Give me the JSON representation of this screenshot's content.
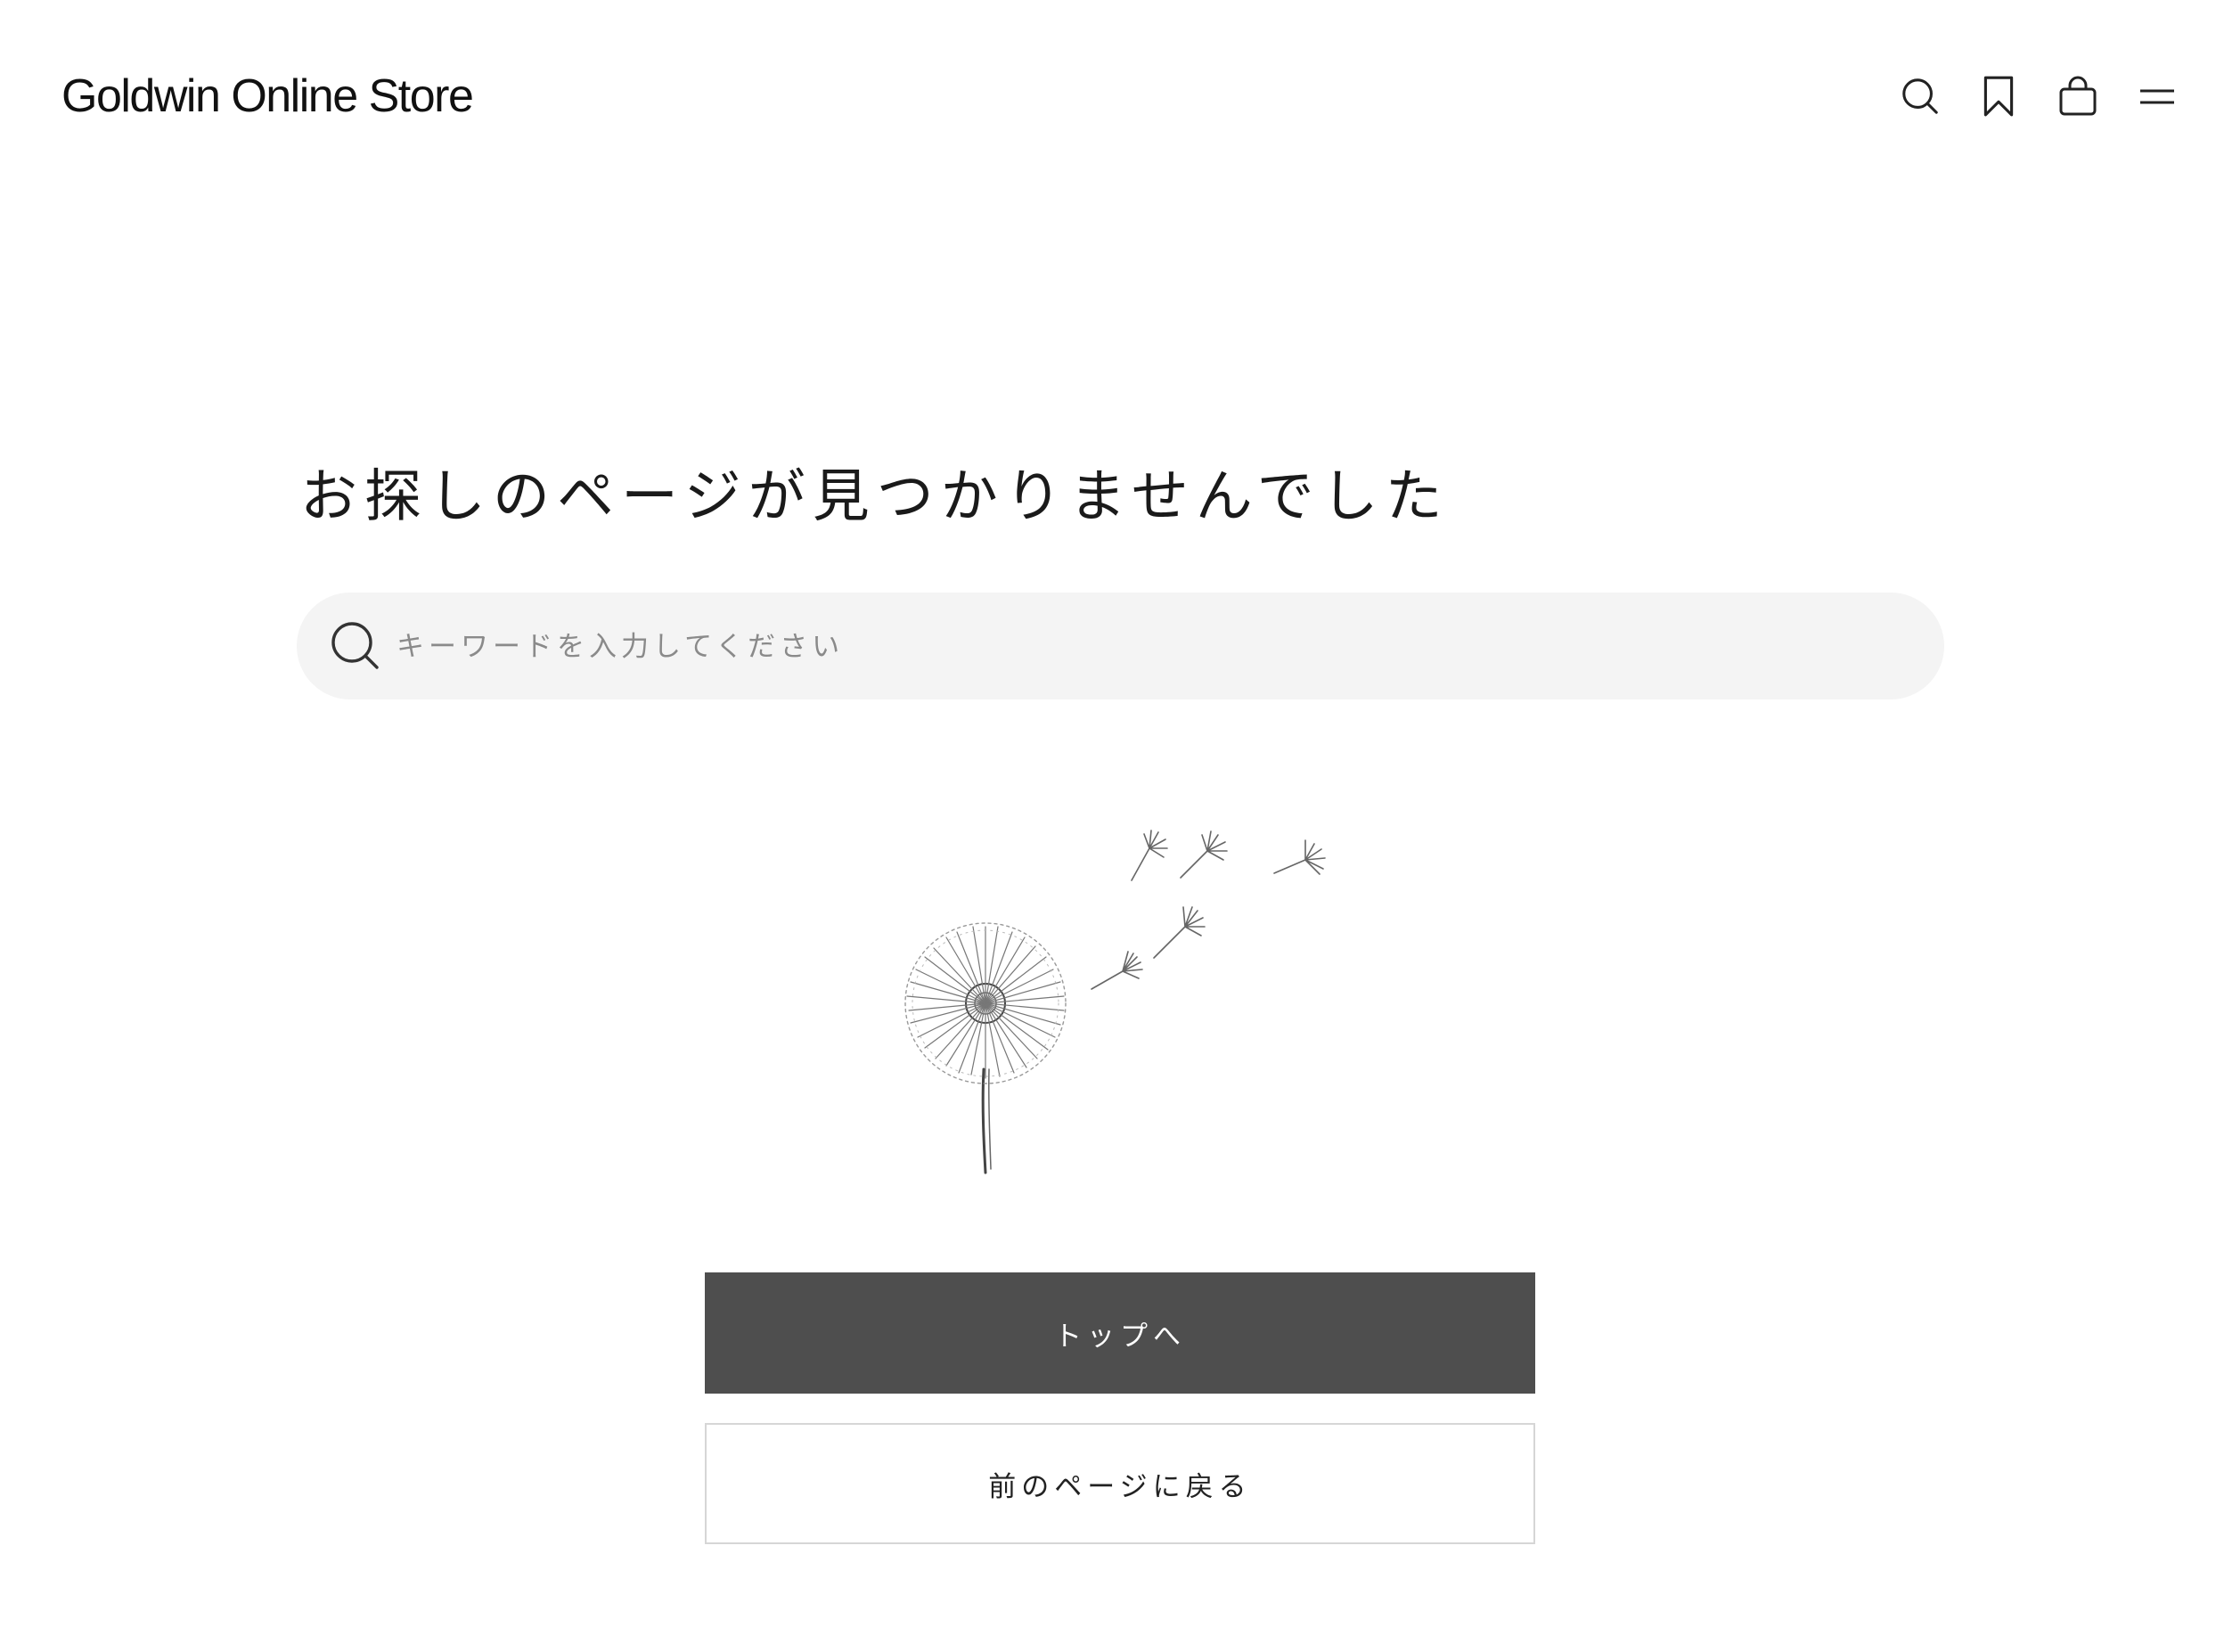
{
  "header": {
    "logo": "Goldwin Online Store",
    "icons": [
      "search-icon",
      "bookmark-icon",
      "bag-icon",
      "menu-icon"
    ]
  },
  "main": {
    "title": "お探しのページが見つかりませんでした",
    "search": {
      "placeholder": "キーワードを入力してください",
      "value": ""
    },
    "illustration": "dandelion-illustration",
    "buttons": {
      "top_label": "トップへ",
      "back_label": "前のページに戻る"
    }
  },
  "colors": {
    "primary_button_bg": "#4e4e4e",
    "search_bg": "#f4f4f4",
    "text": "#1a1a1a"
  }
}
